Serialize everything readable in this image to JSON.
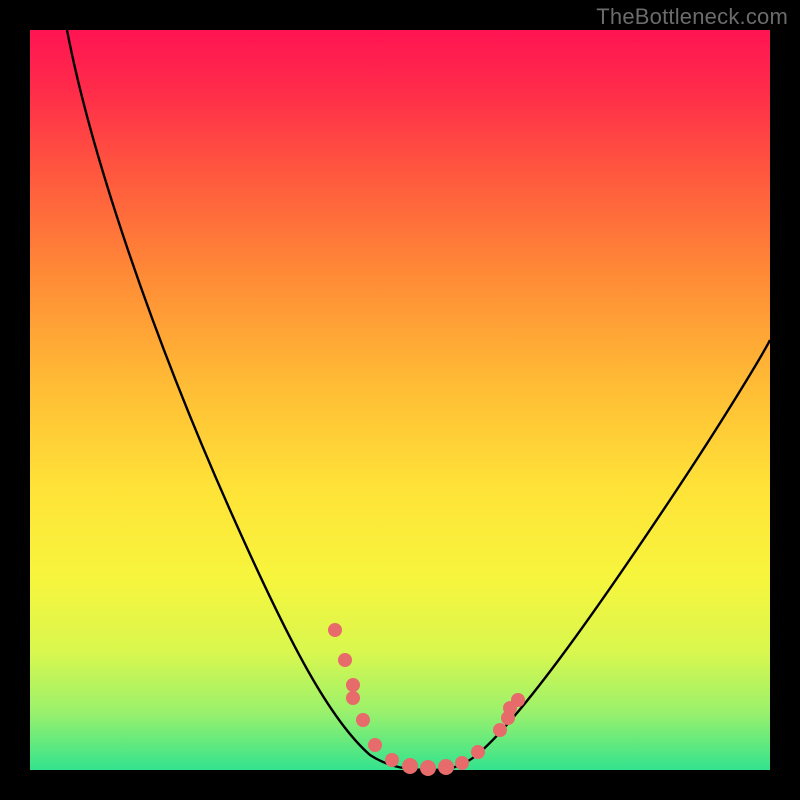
{
  "watermark": "TheBottleneck.com",
  "colors": {
    "frame": "#000000",
    "curve": "#000000",
    "dots": "#e76b6b",
    "gradient_top": "#ff1452",
    "gradient_bottom": "#33e38e"
  },
  "chart_data": {
    "type": "line",
    "title": "",
    "xlabel": "",
    "ylabel": "",
    "xlim": [
      0,
      100
    ],
    "ylim": [
      0,
      100
    ],
    "grid": false,
    "series": [
      {
        "name": "bottleneck-curve",
        "x": [
          5,
          10,
          15,
          20,
          25,
          30,
          35,
          40,
          42,
          44,
          46,
          48,
          50,
          52,
          54,
          56,
          58,
          60,
          65,
          70,
          75,
          80,
          85,
          90,
          95,
          100
        ],
        "y": [
          100,
          87,
          74,
          62,
          51,
          41,
          31,
          21,
          17,
          13,
          9,
          5,
          2,
          0,
          0,
          0,
          1,
          3,
          10,
          18,
          26,
          34,
          41,
          48,
          55,
          61
        ]
      }
    ],
    "highlight_points": {
      "name": "marked-region",
      "x": [
        41,
        43,
        44.5,
        46,
        48,
        50,
        52,
        54,
        56,
        58,
        59.5,
        62,
        63.5,
        65,
        66
      ],
      "y": [
        19,
        15,
        12,
        9,
        5,
        2,
        0,
        0,
        0,
        1,
        2,
        6,
        8,
        10,
        12
      ]
    }
  }
}
